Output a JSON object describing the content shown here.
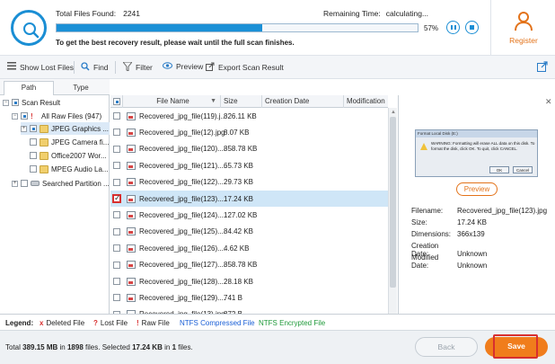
{
  "header": {
    "total_found_label": "Total Files Found:",
    "total_found_value": "2241",
    "remaining_label": "Remaining Time:",
    "remaining_value": "calculating...",
    "progress_percent": 57,
    "progress_text": "57%",
    "hint": "To get the best recovery result, please wait until the full scan finishes.",
    "register_label": "Register",
    "accent_color": "#1b90d6",
    "brand_orange": "#e3731a"
  },
  "toolbar": {
    "show_lost": "Show Lost Files",
    "find": "Find",
    "filter": "Filter",
    "preview": "Preview",
    "export": "Export Scan Result"
  },
  "tabs": {
    "path": "Path",
    "type": "Type"
  },
  "tree": {
    "root": "Scan Result",
    "all_raw": "All Raw Files (947)",
    "items": [
      "JPEG Graphics ...",
      "JPEG Camera fi...",
      "Office2007 Wor...",
      "MPEG Audio La..."
    ],
    "searched": "Searched Partition ..."
  },
  "list": {
    "headers": {
      "name": "File Name",
      "size": "Size",
      "creation": "Creation Date",
      "modification": "Modification"
    },
    "rows": [
      {
        "name": "Recovered_jpg_file(119).j...",
        "size": "826.11 KB"
      },
      {
        "name": "Recovered_jpg_file(12).jpg",
        "size": "8.07 KB"
      },
      {
        "name": "Recovered_jpg_file(120)....",
        "size": "858.78 KB"
      },
      {
        "name": "Recovered_jpg_file(121)....",
        "size": "65.73 KB"
      },
      {
        "name": "Recovered_jpg_file(122)....",
        "size": "29.73 KB"
      },
      {
        "name": "Recovered_jpg_file(123)....",
        "size": "17.24 KB"
      },
      {
        "name": "Recovered_jpg_file(124)....",
        "size": "127.02 KB"
      },
      {
        "name": "Recovered_jpg_file(125)....",
        "size": "84.42 KB"
      },
      {
        "name": "Recovered_jpg_file(126)....",
        "size": "4.62 KB"
      },
      {
        "name": "Recovered_jpg_file(127)....",
        "size": "858.78 KB"
      },
      {
        "name": "Recovered_jpg_file(128)....",
        "size": "28.18 KB"
      },
      {
        "name": "Recovered_jpg_file(129)....",
        "size": "741 B"
      },
      {
        "name": "Recovered_jpg_file(13).jpg",
        "size": "872 B"
      }
    ]
  },
  "preview": {
    "dialog_title": "Format Local Disk (E:)",
    "dialog_msg": "WARNING: Formatting will erase ALL data on this disk. To format the disk, click OK. To quit, click CANCEL.",
    "dialog_ok": "OK",
    "dialog_cancel": "Cancel",
    "button": "Preview",
    "filename_label": "Filename:",
    "filename": "Recovered_jpg_file(123).jpg",
    "size_label": "Size:",
    "size": "17.24 KB",
    "dimensions_label": "Dimensions:",
    "dimensions": "366x139",
    "creation_label": "Creation Date:",
    "creation": "Unknown",
    "modified_label": "Modified Date:",
    "modified": "Unknown"
  },
  "legend": {
    "title": "Legend:",
    "deleted": "Deleted File",
    "lost": "Lost File",
    "raw": "Raw File",
    "ntfs_compressed": "NTFS Compressed File",
    "ntfs_encrypted": "NTFS Encrypted File",
    "deleted_mark": "x",
    "lost_mark": "?",
    "raw_mark": "!",
    "compressed_color": "#1a5fd6",
    "encrypted_color": "#1f9a3a"
  },
  "footer": {
    "total_prefix": "Total",
    "total_size": "389.15 MB",
    "in": "in",
    "total_files": "1898",
    "files_selected": "files.  Selected",
    "selected_size": "17.24 KB",
    "in2": "in",
    "selected_files": "1",
    "files_end": "files.",
    "back": "Back",
    "save": "Save"
  }
}
